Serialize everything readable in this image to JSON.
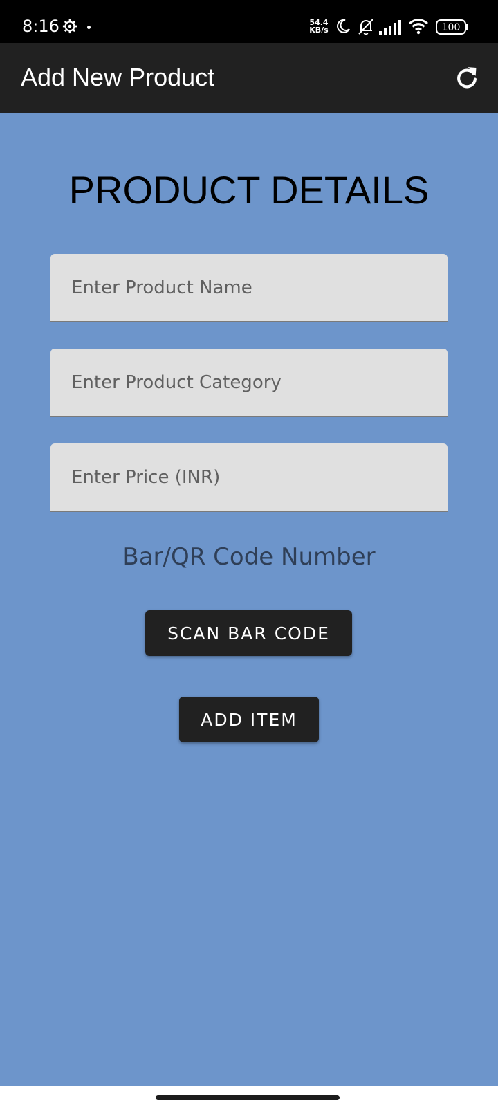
{
  "status_bar": {
    "time": "8:16",
    "net_speed_value": "54.4",
    "net_speed_unit": "KB/s",
    "battery": "100",
    "icons": [
      "gear-icon",
      "moon-icon",
      "bell-off-icon",
      "signal-icon",
      "wifi-icon",
      "battery-icon"
    ]
  },
  "app_bar": {
    "title": "Add New Product",
    "action_icon": "refresh-icon"
  },
  "form": {
    "heading": "PRODUCT DETAILS",
    "fields": [
      {
        "placeholder": "Enter Product Name",
        "value": ""
      },
      {
        "placeholder": "Enter Product Category",
        "value": ""
      },
      {
        "placeholder": "Enter Price (INR)",
        "value": ""
      }
    ],
    "barcode_label": "Bar/QR Code Number",
    "scan_button": "SCAN BAR CODE",
    "add_button": "ADD ITEM"
  },
  "colors": {
    "background": "#6d95cb",
    "app_bar": "#212121",
    "field_bg": "#e0e0e0",
    "button_bg": "#212121"
  }
}
